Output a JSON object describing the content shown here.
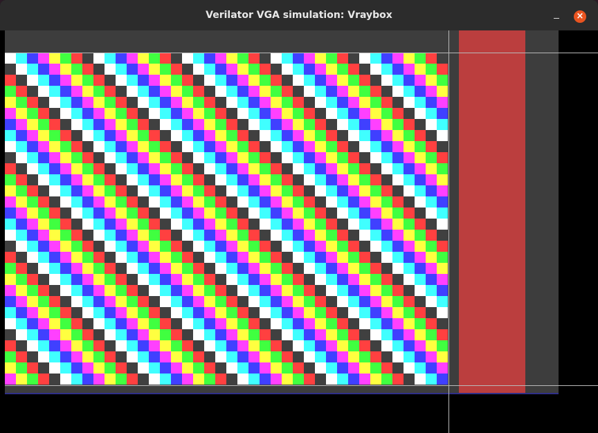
{
  "window": {
    "title": "Verilator VGA simulation: Vraybox",
    "minimize_glyph": "",
    "close_glyph": "×"
  },
  "colors": {
    "titlebar": "#2c2c2c",
    "frame_gray": "#3d3d3d",
    "red_bar": "#bb3e3e",
    "close_button": "#e95420",
    "palette": [
      "#ffffff",
      "#40ffff",
      "#4040ff",
      "#ff40ff",
      "#ffff40",
      "#40ff40",
      "#ff4040",
      "#404040"
    ]
  },
  "pattern": {
    "columns": 40,
    "rows": 30,
    "description_order": "diagonal color cycling"
  }
}
